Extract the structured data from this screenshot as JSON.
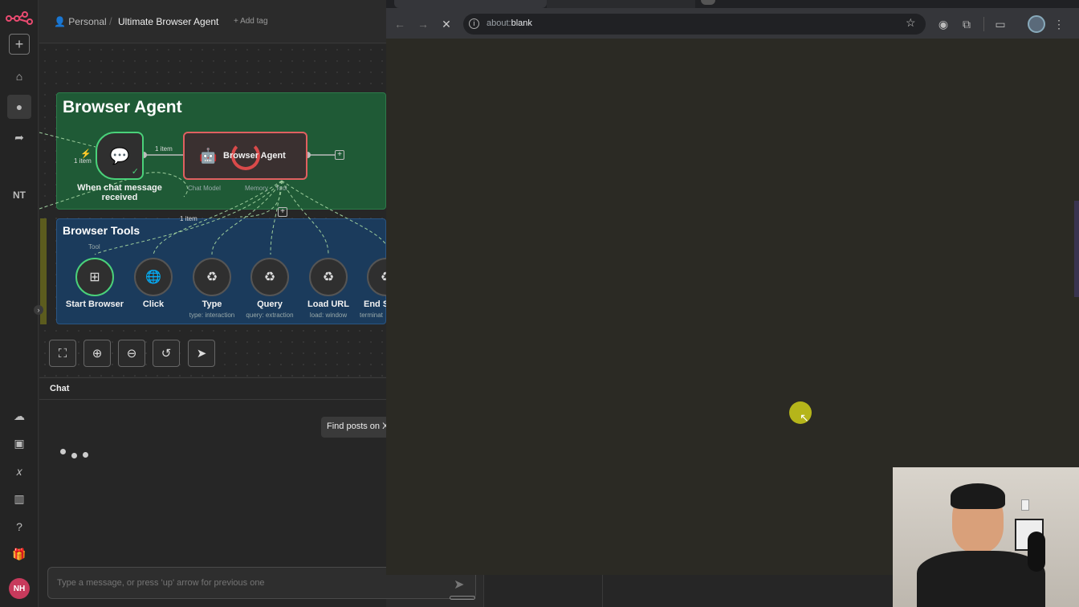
{
  "sidebar": {
    "logo_icon": "n8n-logo-icon",
    "initials": "NT",
    "avatar": "NH",
    "accent": "#ea4b71"
  },
  "topbar": {
    "project": "Personal",
    "workflow_name": "Ultimate Browser Agent",
    "add_tag": "+ Add tag"
  },
  "canvas": {
    "agent_sticky_title": "Browser Agent",
    "tools_sticky_title": "Browser Tools",
    "trigger_node": {
      "label_line1": "When chat message",
      "label_line2": "received"
    },
    "trigger_items": "1 item",
    "edge_items": "1 item",
    "agent_node": {
      "label": "Browser Agent"
    },
    "agent_ports": {
      "chat_model": "Chat Model",
      "memory": "Memory",
      "tool": "Tool"
    },
    "tools_items": "1 item",
    "tool_port_label": "Tool",
    "tools": [
      {
        "label": "Start Browser",
        "sub": ""
      },
      {
        "label": "Click",
        "sub": ""
      },
      {
        "label": "Type",
        "sub": "type: interaction"
      },
      {
        "label": "Query",
        "sub": "query: extraction"
      },
      {
        "label": "Load URL",
        "sub": "load: window"
      },
      {
        "label": "End S",
        "sub": "terminat"
      }
    ]
  },
  "chat": {
    "title": "Chat",
    "message": "Find posts on X",
    "input_placeholder": "Type a message, or press 'up' arrow for previous one"
  },
  "browser": {
    "url_prefix": "about:",
    "url_main": "blank"
  }
}
